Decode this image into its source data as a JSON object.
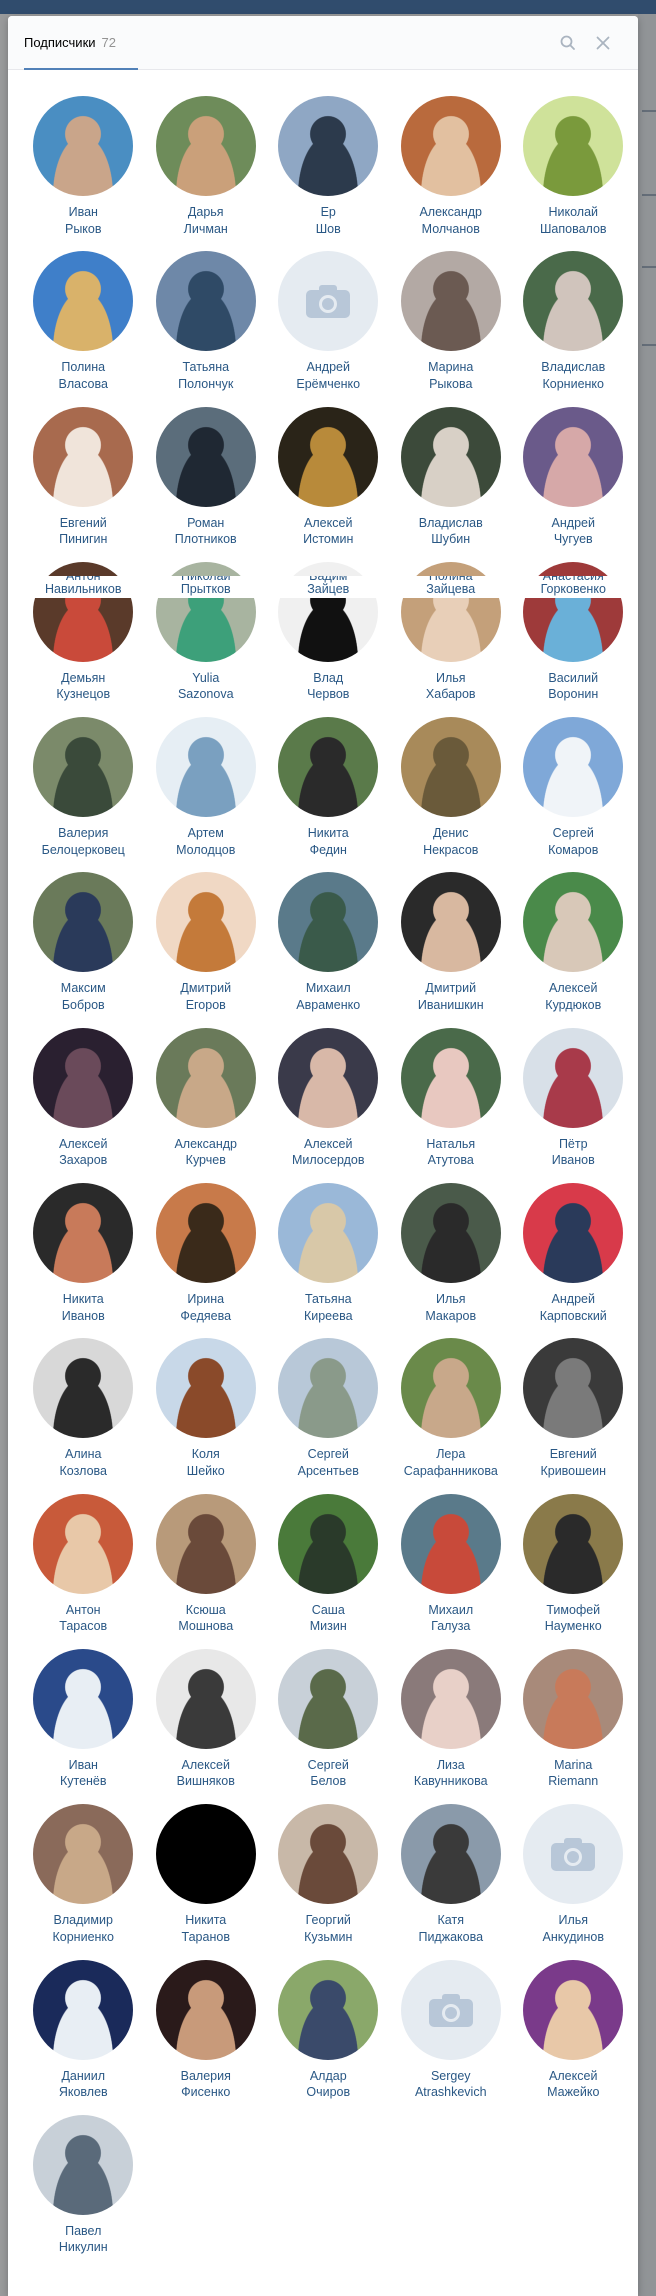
{
  "header": {
    "tab_label": "Подписчики",
    "tab_count": "72"
  },
  "overlap_names": [
    {
      "first": "Антон",
      "last": "Навильников"
    },
    {
      "first": "Николай",
      "last": "Прытков"
    },
    {
      "first": "Вадим",
      "last": "Зайцев"
    },
    {
      "first": "Полина",
      "last": "Зайцева"
    },
    {
      "first": "Анастасия",
      "last": "Горковенко"
    }
  ],
  "followers": [
    {
      "first": "Иван",
      "last": "Рыков",
      "colors": [
        "#4a8ec2",
        "#c9a58a"
      ]
    },
    {
      "first": "Дарья",
      "last": "Личман",
      "colors": [
        "#6e8c5a",
        "#caa07a"
      ]
    },
    {
      "first": "Ер",
      "last": "Шов",
      "colors": [
        "#8fa7c4",
        "#2c3a4c"
      ]
    },
    {
      "first": "Александр",
      "last": "Молчанов",
      "colors": [
        "#b96a3d",
        "#e2c0a0"
      ]
    },
    {
      "first": "Николай",
      "last": "Шаповалов",
      "colors": [
        "#cfe29a",
        "#7a9a3c"
      ]
    },
    {
      "first": "Полина",
      "last": "Власова",
      "colors": [
        "#3f7fc9",
        "#d9b26a"
      ]
    },
    {
      "first": "Татьяна",
      "last": "Полончук",
      "colors": [
        "#6e88a8",
        "#2f4a66"
      ]
    },
    {
      "first": "Андрей",
      "last": "Ерёмченко",
      "photo": false
    },
    {
      "first": "Марина",
      "last": "Рыкова",
      "colors": [
        "#b3a9a4",
        "#6b5a52"
      ]
    },
    {
      "first": "Владислав",
      "last": "Корниенко",
      "colors": [
        "#4a6a4a",
        "#d0c4bc"
      ]
    },
    {
      "first": "Евгений",
      "last": "Пинигин",
      "colors": [
        "#a86a4e",
        "#f0e4da"
      ]
    },
    {
      "first": "Роман",
      "last": "Плотников",
      "colors": [
        "#5b6d7b",
        "#1f2833"
      ]
    },
    {
      "first": "Алексей",
      "last": "Истомин",
      "colors": [
        "#2a2418",
        "#b88a3a"
      ]
    },
    {
      "first": "Владислав",
      "last": "Шубин",
      "colors": [
        "#3c4a3a",
        "#d8d0c6"
      ]
    },
    {
      "first": "Андрей",
      "last": "Чугуев",
      "colors": [
        "#6a5a8a",
        "#d6a8a8"
      ]
    },
    {
      "first": "Демьян",
      "last": "Кузнецов",
      "colors": [
        "#5a3a2a",
        "#c94a3a"
      ]
    },
    {
      "first": "Yulia",
      "last": "Sazonova",
      "colors": [
        "#a8b4a0",
        "#3da07a"
      ]
    },
    {
      "first": "Влад",
      "last": "Червов",
      "colors": [
        "#f0f0f0",
        "#111111"
      ]
    },
    {
      "first": "Илья",
      "last": "Хабаров",
      "colors": [
        "#c4a07a",
        "#e8cfb8"
      ]
    },
    {
      "first": "Василий",
      "last": "Воронин",
      "colors": [
        "#9e3a3a",
        "#6ab0d8"
      ]
    },
    {
      "first": "Валерия",
      "last": "Белоцерковец",
      "colors": [
        "#7b8a6a",
        "#3a4a3a"
      ]
    },
    {
      "first": "Артем",
      "last": "Молодцов",
      "colors": [
        "#e6eef4",
        "#7aa0c0"
      ]
    },
    {
      "first": "Никита",
      "last": "Федин",
      "colors": [
        "#5a7a4a",
        "#2a2a2a"
      ]
    },
    {
      "first": "Денис",
      "last": "Некрасов",
      "colors": [
        "#a88a5a",
        "#6a5a3a"
      ]
    },
    {
      "first": "Сергей",
      "last": "Комаров",
      "colors": [
        "#7fa8d8",
        "#f0f4f8"
      ]
    },
    {
      "first": "Максим",
      "last": "Бобров",
      "colors": [
        "#6a7a5a",
        "#2a3a5a"
      ]
    },
    {
      "first": "Дмитрий",
      "last": "Егоров",
      "colors": [
        "#f0d8c4",
        "#c47a3a"
      ]
    },
    {
      "first": "Михаил",
      "last": "Авраменко",
      "colors": [
        "#5a7a8a",
        "#3a5a4a"
      ]
    },
    {
      "first": "Дмитрий",
      "last": "Иванишкин",
      "colors": [
        "#2a2a2a",
        "#d8b8a0"
      ]
    },
    {
      "first": "Алексей",
      "last": "Курдюков",
      "colors": [
        "#4a8a4a",
        "#d8c8b8"
      ]
    },
    {
      "first": "Алексей",
      "last": "Захаров",
      "colors": [
        "#2a2030",
        "#6a4a5a"
      ]
    },
    {
      "first": "Александр",
      "last": "Курчев",
      "colors": [
        "#6a7a5a",
        "#c8a888"
      ]
    },
    {
      "first": "Алексей",
      "last": "Милосердов",
      "colors": [
        "#3a3a4a",
        "#d8b8a8"
      ]
    },
    {
      "first": "Наталья",
      "last": "Атутова",
      "colors": [
        "#4a6a4a",
        "#e8c8c0"
      ]
    },
    {
      "first": "Пётр",
      "last": "Иванов",
      "colors": [
        "#d8e0e8",
        "#a83a4a"
      ]
    },
    {
      "first": "Никита",
      "last": "Иванов",
      "colors": [
        "#2a2a2a",
        "#c87a5a"
      ]
    },
    {
      "first": "Ирина",
      "last": "Федяева",
      "colors": [
        "#c87a4a",
        "#3a2a1a"
      ]
    },
    {
      "first": "Татьяна",
      "last": "Киреева",
      "colors": [
        "#9ab8d8",
        "#d8c8a8"
      ]
    },
    {
      "first": "Илья",
      "last": "Макаров",
      "colors": [
        "#4a5a4a",
        "#2a2a2a"
      ]
    },
    {
      "first": "Андрей",
      "last": "Карповский",
      "colors": [
        "#d83a4a",
        "#2a3a5a"
      ]
    },
    {
      "first": "Алина",
      "last": "Козлова",
      "colors": [
        "#d8d8d8",
        "#2a2a2a"
      ]
    },
    {
      "first": "Коля",
      "last": "Шейко",
      "colors": [
        "#c8d8e8",
        "#8a4a2a"
      ]
    },
    {
      "first": "Сергей",
      "last": "Арсентьев",
      "colors": [
        "#b8c8d8",
        "#8a9a8a"
      ]
    },
    {
      "first": "Лера",
      "last": "Сарафанникова",
      "colors": [
        "#6a8a4a",
        "#c8a88a"
      ]
    },
    {
      "first": "Евгений",
      "last": "Кривошеин",
      "colors": [
        "#3a3a3a",
        "#7a7a7a"
      ]
    },
    {
      "first": "Антон",
      "last": "Тарасов",
      "colors": [
        "#c85a3a",
        "#e8c8a8"
      ]
    },
    {
      "first": "Ксюша",
      "last": "Мошнова",
      "colors": [
        "#b89a7a",
        "#6a4a3a"
      ]
    },
    {
      "first": "Саша",
      "last": "Мизин",
      "colors": [
        "#4a7a3a",
        "#2a3a2a"
      ]
    },
    {
      "first": "Михаил",
      "last": "Галуза",
      "colors": [
        "#5a7a8a",
        "#c84a3a"
      ]
    },
    {
      "first": "Тимофей",
      "last": "Науменко",
      "colors": [
        "#8a7a4a",
        "#2a2a2a"
      ]
    },
    {
      "first": "Иван",
      "last": "Кутенёв",
      "colors": [
        "#2a4a8a",
        "#e8eef4"
      ]
    },
    {
      "first": "Алексей",
      "last": "Вишняков",
      "colors": [
        "#e8e8e8",
        "#3a3a3a"
      ]
    },
    {
      "first": "Сергей",
      "last": "Белов",
      "colors": [
        "#c8d0d8",
        "#5a6a4a"
      ]
    },
    {
      "first": "Лиза",
      "last": "Кавунникова",
      "colors": [
        "#8a7a7a",
        "#e8d0c8"
      ]
    },
    {
      "first": "Marina",
      "last": "Riemann",
      "colors": [
        "#a88a7a",
        "#c87a5a"
      ]
    },
    {
      "first": "Владимир",
      "last": "Корниенко",
      "colors": [
        "#8a6a5a",
        "#c8a888"
      ]
    },
    {
      "first": "Никита",
      "last": "Таранов",
      "colors": [
        "#000000",
        "#000000"
      ]
    },
    {
      "first": "Георгий",
      "last": "Кузьмин",
      "colors": [
        "#c8b8a8",
        "#6a4a3a"
      ]
    },
    {
      "first": "Катя",
      "last": "Пиджакова",
      "colors": [
        "#8a9aaa",
        "#3a3a3a"
      ]
    },
    {
      "first": "Илья",
      "last": "Анкудинов",
      "photo": false
    },
    {
      "first": "Даниил",
      "last": "Яковлев",
      "colors": [
        "#1a2a5a",
        "#e8eef4"
      ]
    },
    {
      "first": "Валерия",
      "last": "Фисенко",
      "colors": [
        "#2a1a1a",
        "#c89a7a"
      ]
    },
    {
      "first": "Алдар",
      "last": "Очиров",
      "colors": [
        "#8aa86a",
        "#3a4a6a"
      ]
    },
    {
      "first": "Sergey",
      "last": "Atrashkevich",
      "photo": false
    },
    {
      "first": "Алексей",
      "last": "Мажейко",
      "colors": [
        "#7a3a8a",
        "#e8c8a8"
      ]
    },
    {
      "first": "Павел",
      "last": "Никулин",
      "colors": [
        "#c8d0d8",
        "#5a6a7a"
      ]
    }
  ]
}
